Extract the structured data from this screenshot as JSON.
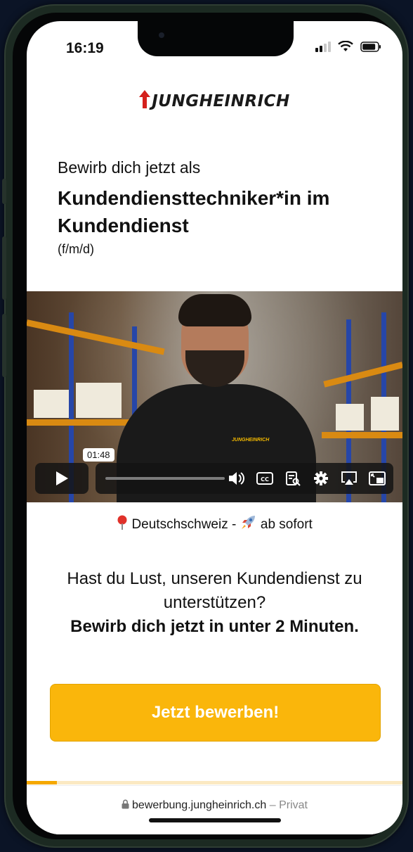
{
  "status_bar": {
    "time": "16:19",
    "signal_bars_active": 2,
    "signal_bars_total": 4,
    "icons": [
      "signal-icon",
      "wifi-icon",
      "battery-icon"
    ]
  },
  "brand": {
    "logo_text": "JUNGHEINRICH",
    "accent_color": "#fab60b",
    "logo_arrow_color": "#d4201c"
  },
  "intro": {
    "line1": "Bewirb dich jetzt als",
    "job_title": "Kundendiensttechniker*in im Kundendienst",
    "suffix": "(f/m/d)"
  },
  "video": {
    "shirt_logo": "JUNGHEINRICH",
    "time_tooltip": "01:48",
    "progress_fraction": 0.0,
    "controls": [
      "play-icon",
      "volume-icon",
      "captions-icon",
      "transcript-icon",
      "settings-gear-icon",
      "airplay-icon",
      "picture-in-picture-icon"
    ]
  },
  "location": {
    "region": "Deutschschweiz -",
    "start": "ab sofort",
    "pin_icon": "map-pin-icon",
    "rocket_icon": "rocket-icon"
  },
  "pitch": {
    "question": "Hast du Lust, unseren Kundendienst zu unterstützen?",
    "call": "Bewirb dich jetzt in unter 2 Minuten."
  },
  "cta": {
    "label": "Jetzt bewerben!"
  },
  "form_progress": {
    "fraction": 0.08
  },
  "browser": {
    "domain": "bewerbung.jungheinrich.ch",
    "separator": "–",
    "mode": "Privat"
  }
}
